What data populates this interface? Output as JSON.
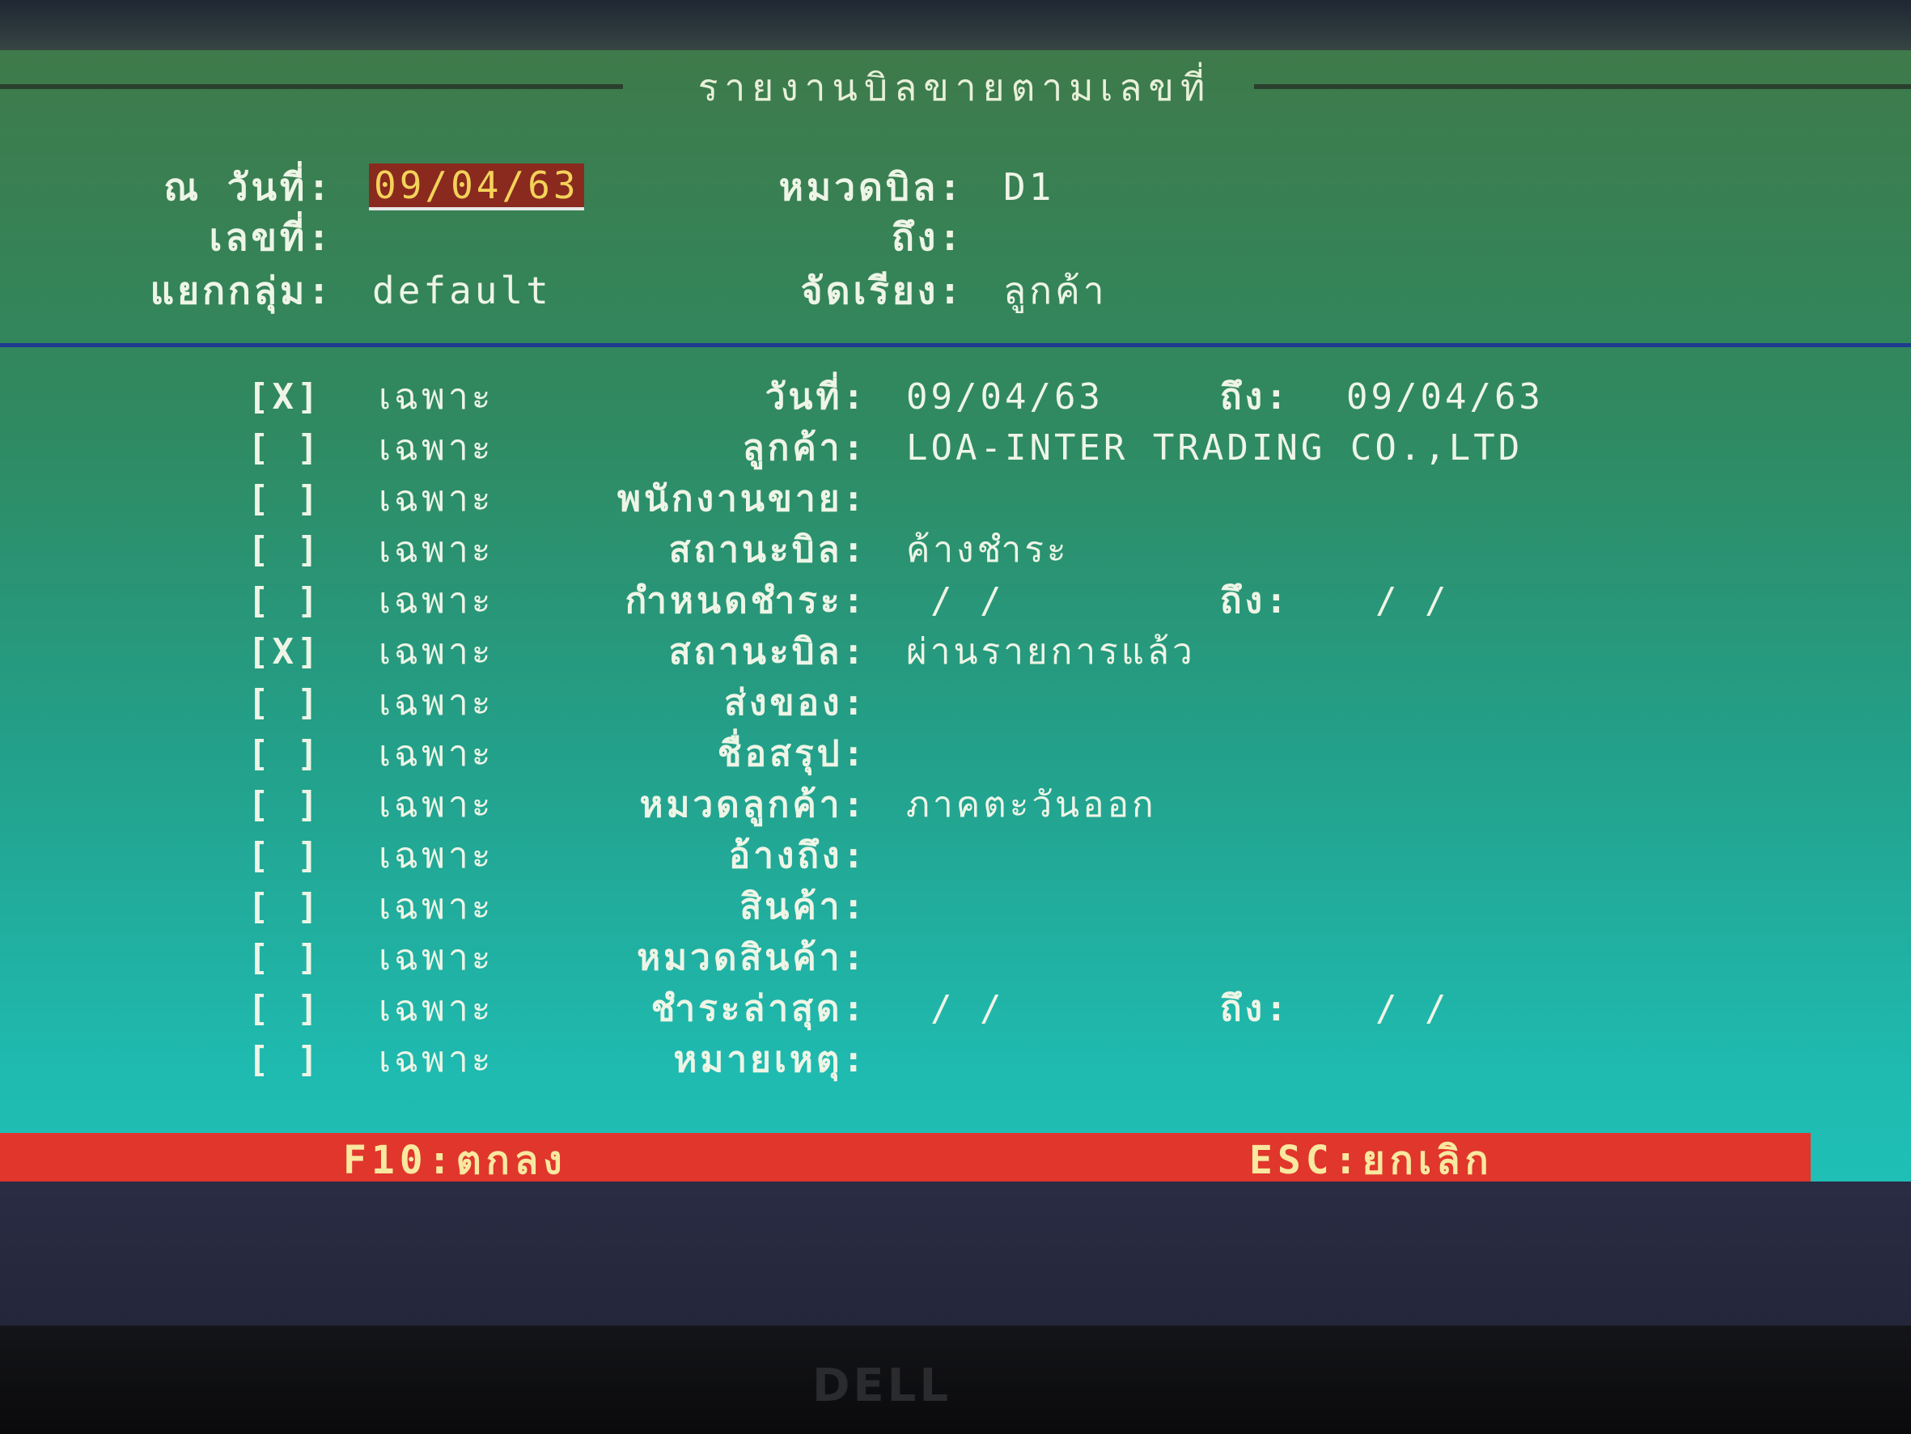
{
  "title": "รายงานบิลขายตามเลขที่",
  "header": {
    "date_label": "ณ วันที่:",
    "date_value": "09/04/63",
    "category_label": "หมวดบิล:",
    "category_value": "D1",
    "number_label": "เลขที่:",
    "to_label": "ถึง:",
    "group_label": "แยกกลุ่ม:",
    "group_value": "default",
    "sort_label": "จัดเรียง:",
    "sort_value": "ลูกค้า"
  },
  "filters": [
    {
      "check": "[X]",
      "only": "เฉพาะ",
      "label": "วันที่:",
      "value": "09/04/63",
      "to_label": "ถึง:",
      "to_value": "09/04/63"
    },
    {
      "check": "[ ]",
      "only": "เฉพาะ",
      "label": "ลูกค้า:",
      "value": "LOA-INTER TRADING CO.,LTD"
    },
    {
      "check": "[ ]",
      "only": "เฉพาะ",
      "label": "พนักงานขาย:",
      "value": ""
    },
    {
      "check": "[ ]",
      "only": "เฉพาะ",
      "label": "สถานะบิล:",
      "value": "ค้างชำระ"
    },
    {
      "check": "[ ]",
      "only": "เฉพาะ",
      "label": "กำหนดชำระ:",
      "value": "  /  /",
      "to_label": "ถึง:",
      "to_value": "  /  /"
    },
    {
      "check": "[X]",
      "only": "เฉพาะ",
      "label": "สถานะบิล:",
      "value": "ผ่านรายการแล้ว"
    },
    {
      "check": "[ ]",
      "only": "เฉพาะ",
      "label": "ส่งของ:",
      "value": ""
    },
    {
      "check": "[ ]",
      "only": "เฉพาะ",
      "label": "ชื่อสรุป:",
      "value": ""
    },
    {
      "check": "[ ]",
      "only": "เฉพาะ",
      "label": "หมวดลูกค้า:",
      "value": "ภาคตะวันออก"
    },
    {
      "check": "[ ]",
      "only": "เฉพาะ",
      "label": "อ้างถึง:",
      "value": ""
    },
    {
      "check": "[ ]",
      "only": "เฉพาะ",
      "label": "สินค้า:",
      "value": ""
    },
    {
      "check": "[ ]",
      "only": "เฉพาะ",
      "label": "หมวดสินค้า:",
      "value": ""
    },
    {
      "check": "[ ]",
      "only": "เฉพาะ",
      "label": "ชำระล่าสุด:",
      "value": "  /  /",
      "to_label": "ถึง:",
      "to_value": "  /  /"
    },
    {
      "check": "[ ]",
      "only": "เฉพาะ",
      "label": "หมายเหตุ:",
      "value": ""
    }
  ],
  "footer": {
    "ok_label": "F10:ตกลง",
    "cancel_label": "ESC:ยกเลิก"
  },
  "brand": "DELL",
  "colors": {
    "screen_top": "#3e7a4a",
    "screen_bottom": "#20c6bc",
    "footer_bar": "#e0362c",
    "date_highlight": "#8a2a1e",
    "divider": "#1f3a8e"
  }
}
